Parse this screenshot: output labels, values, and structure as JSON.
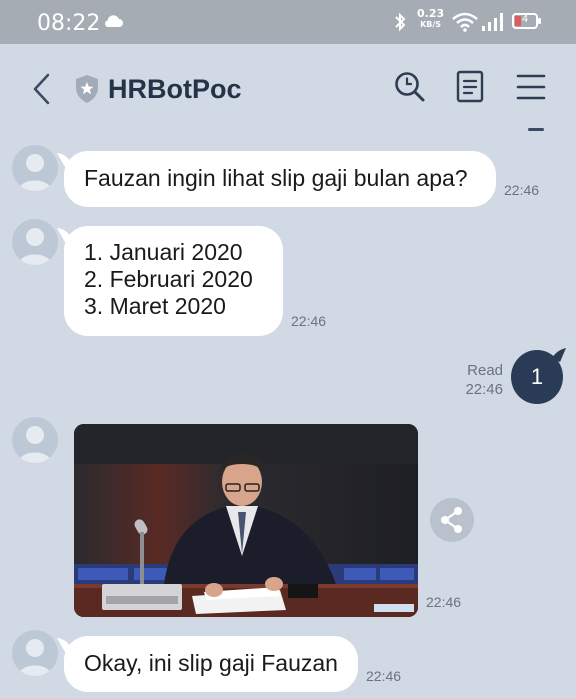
{
  "status_bar": {
    "time": "08:22",
    "net_speed_value": "0.23",
    "net_speed_unit": "KB/S",
    "battery_level": "4",
    "icons": [
      "cloud-icon",
      "bluetooth-icon",
      "wifi-icon",
      "signal-icon",
      "battery-icon"
    ]
  },
  "header": {
    "title": "HRBotPoc",
    "icons": [
      "back-icon",
      "shield-icon",
      "search-icon",
      "note-icon",
      "menu-icon"
    ]
  },
  "messages": [
    {
      "type": "received",
      "lines": [
        "Fauzan ingin lihat slip gaji bulan apa?"
      ],
      "time": "22:46"
    },
    {
      "type": "received",
      "lines": [
        "1. Januari 2020",
        "2. Februari 2020",
        "3. Maret 2020"
      ],
      "time": "22:46"
    },
    {
      "type": "sent",
      "text": "1",
      "read_label": "Read",
      "time": "22:46"
    },
    {
      "type": "received_image",
      "time": "22:46"
    },
    {
      "type": "received",
      "lines": [
        "Okay, ini slip gaji Fauzan"
      ],
      "time": "22:46"
    }
  ],
  "colors": {
    "background": "#d1d9e4",
    "status_bar": "#a6acb3",
    "sent_bubble": "#2a3b55",
    "received_bubble": "#ffffff",
    "title": "#243448"
  }
}
